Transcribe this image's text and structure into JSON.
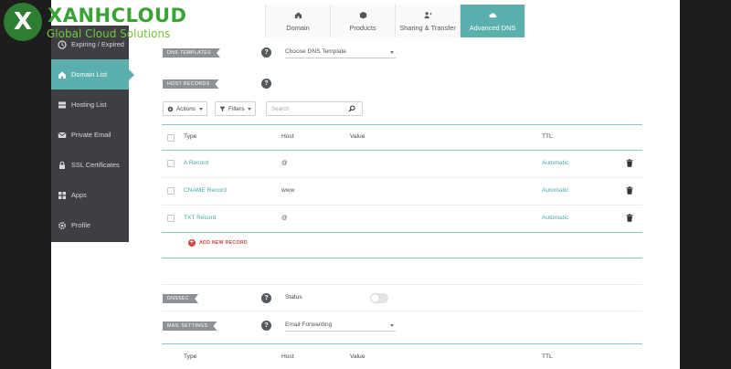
{
  "logo": {
    "mark": "X",
    "name": "XANHCLOUD",
    "tagline": "Global Cloud Solutions"
  },
  "sidebar": {
    "items": [
      {
        "label": "Expiring / Expired",
        "icon": "clock-icon"
      },
      {
        "label": "Domain List",
        "icon": "home-icon",
        "active": true
      },
      {
        "label": "Hosting List",
        "icon": "server-icon"
      },
      {
        "label": "Private Email",
        "icon": "envelope-icon"
      },
      {
        "label": "SSL Certificates",
        "icon": "lock-icon"
      },
      {
        "label": "Apps",
        "icon": "apps-grid-icon"
      },
      {
        "label": "Profile",
        "icon": "gear-icon"
      }
    ]
  },
  "tabs": [
    {
      "label": "Domain",
      "icon": "home-icon"
    },
    {
      "label": "Products",
      "icon": "box-icon"
    },
    {
      "label": "Sharing & Transfer",
      "icon": "share-user-icon"
    },
    {
      "label": "Advanced DNS",
      "icon": "cloud-icon",
      "active": true
    }
  ],
  "dns_templates": {
    "label": "DNS TEMPLATES",
    "select_value": "Choose DNS Template"
  },
  "host_records": {
    "label": "HOST RECORDS",
    "actions_label": "Actions",
    "filters_label": "Filters",
    "search_placeholder": "Search",
    "columns": {
      "type": "Type",
      "host": "Host",
      "value": "Value",
      "ttl": "TTL"
    },
    "rows": [
      {
        "type": "A Record",
        "host": "@",
        "value": "",
        "ttl": "Automatic"
      },
      {
        "type": "CNAME Record",
        "host": "www",
        "value": "",
        "ttl": "Automatic"
      },
      {
        "type": "TXT Record",
        "host": "@",
        "value": "",
        "ttl": "Automatic"
      }
    ],
    "add_label": "ADD NEW RECORD"
  },
  "dnssec": {
    "label": "DNSSEC",
    "status_label": "Status"
  },
  "mail_settings": {
    "label": "MAIL SETTINGS",
    "select_value": "Email Forwarding",
    "columns": {
      "type": "Type",
      "host": "Host",
      "value": "Value",
      "ttl": "TTL"
    }
  },
  "colors": {
    "accent": "#5bb0ad",
    "sidebar_bg": "#3d3f43",
    "danger": "#d9453f"
  }
}
